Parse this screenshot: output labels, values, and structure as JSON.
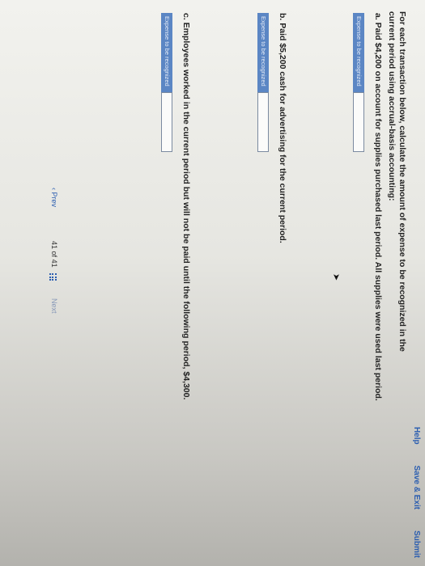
{
  "topbar": {
    "help": "Help",
    "save_exit": "Save & Exit",
    "submit": "Submit"
  },
  "instructions": "For each transaction below, calculate the amount of expense to be recognized in the current period using accrual-basis accounting:",
  "questions": [
    {
      "text": "a. Paid $4,200 on account for supplies purchased last period. All supplies were used last period.",
      "label": "Expense to be recognized",
      "value": ""
    },
    {
      "text": "b. Paid $5,200 cash for advertising for the current period.",
      "label": "Expense to be recognized",
      "value": ""
    },
    {
      "text": "c. Employees worked in the current period but will not be paid until the following period, $4,300.",
      "label": "Expense to be recognized",
      "value": ""
    }
  ],
  "footer": {
    "prev": "Prev",
    "page_current": "41",
    "page_of": "of",
    "page_total": "41",
    "next": "Next"
  },
  "icons": {
    "prev": "chevron-left-icon",
    "grid": "grid-icon",
    "cursor": "mouse-pointer-icon"
  },
  "colors": {
    "accent": "#2a5db0",
    "label_bg": "#5b86c4"
  }
}
